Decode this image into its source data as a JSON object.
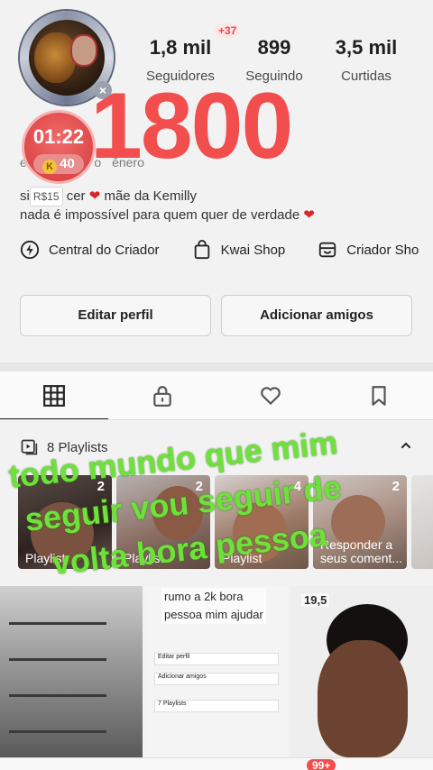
{
  "profile": {
    "new_badge": "+37",
    "stats": {
      "followers": {
        "value": "1,8 mil",
        "label": "Seguidores"
      },
      "following": {
        "value": "899",
        "label": "Seguindo"
      },
      "likes": {
        "value": "3,5 mil",
        "label": "Curtidas"
      }
    },
    "big_number": "1800",
    "timer": {
      "time": "01:22",
      "coins": "40",
      "coin_symbol": "K"
    },
    "tags": [
      "e",
      "yrib",
      "Fe",
      "o",
      "ênero"
    ],
    "bio": {
      "line1_prefix": "si",
      "reward": "R$15",
      "line1_mid": "cer",
      "line1_suffix": "mãe da Kemilly",
      "line2": "nada é impossível para quem quer de verdade"
    }
  },
  "quick_links": [
    {
      "label": "Central do Criador",
      "icon": "lightning-circle-icon"
    },
    {
      "label": "Kwai Shop",
      "icon": "shopping-bag-icon"
    },
    {
      "label": "Criador Sho",
      "icon": "store-icon"
    }
  ],
  "actions": {
    "edit_profile": "Editar perfil",
    "add_friends": "Adicionar amigos"
  },
  "tabs": [
    {
      "name": "grid",
      "icon": "grid-icon",
      "active": true
    },
    {
      "name": "private",
      "icon": "lock-icon",
      "active": false
    },
    {
      "name": "likes",
      "icon": "heart-icon",
      "active": false
    },
    {
      "name": "saved",
      "icon": "bookmark-icon",
      "active": false
    }
  ],
  "playlists": {
    "header": "8 Playlists",
    "items": [
      {
        "count": "2",
        "label": "Playlist"
      },
      {
        "count": "2",
        "label": "Playlist"
      },
      {
        "count": "4",
        "label": "Playlist"
      },
      {
        "count": "2",
        "label": "Responder a\nseus coment..."
      },
      {
        "count": "",
        "label": ""
      }
    ]
  },
  "videos": {
    "item2_text": "rumo a 2k bora\npessoa mim ajudar",
    "item2_ui": {
      "edit": "Editar perfil",
      "add": "Adicionar amigos",
      "playlists": "7 Playlists"
    },
    "item3_value": "19,5"
  },
  "overlay_caption": {
    "line1": "todo mundo que mim",
    "line2": "seguir vou seguir de",
    "line3": "volta bora pessoa"
  },
  "bottom_badge": "99+",
  "colors": {
    "accent_red": "#f24e4e",
    "caption_green": "#6ee23b"
  }
}
